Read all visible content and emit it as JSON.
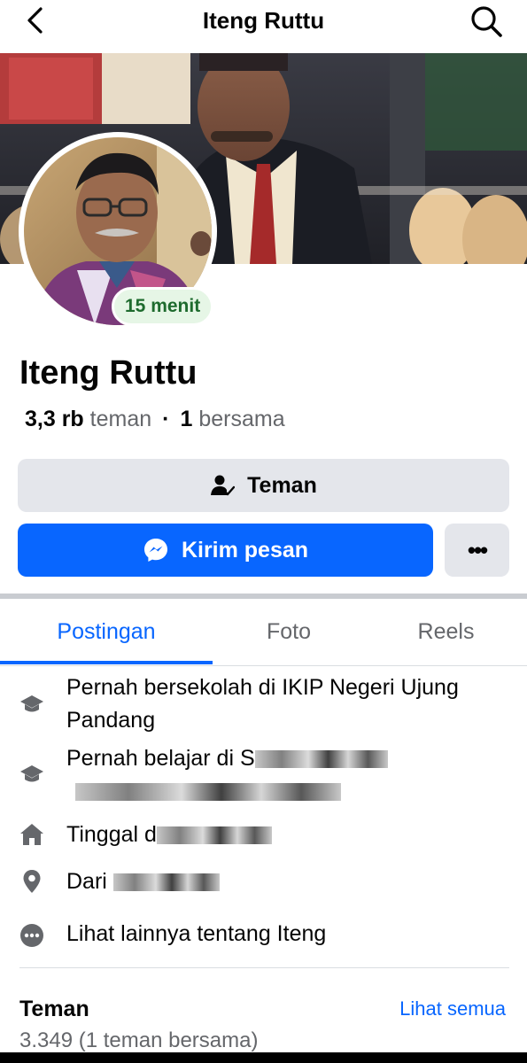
{
  "header": {
    "title": "Iteng Ruttu",
    "back_icon": "chevron-left-icon",
    "search_icon": "search-icon"
  },
  "profile": {
    "name": "Iteng Ruttu",
    "status_badge": "15 menit",
    "friends_count": "3,3 rb",
    "friends_word": "teman",
    "mutual_count": "1",
    "mutual_word": "bersama"
  },
  "actions": {
    "friends_button": "Teman",
    "message_button": "Kirim pesan",
    "more_button": "•••"
  },
  "tabs": [
    {
      "label": "Postingan",
      "active": true
    },
    {
      "label": "Foto",
      "active": false
    },
    {
      "label": "Reels",
      "active": false
    }
  ],
  "about": {
    "school": "Pernah bersekolah di IKIP Negeri Ujung Pandang",
    "studied_prefix": "Pernah belajar di S",
    "lives_prefix": "Tinggal d",
    "from_prefix": "Dari ",
    "see_more": "Lihat lainnya tentang Iteng"
  },
  "friends_section": {
    "title": "Teman",
    "see_all": "Lihat semua",
    "count_line": "3.349 (1 teman bersama)"
  },
  "colors": {
    "accent": "#0866ff",
    "button_gray": "#e4e6eb",
    "status_green": "#1e6b2e"
  }
}
